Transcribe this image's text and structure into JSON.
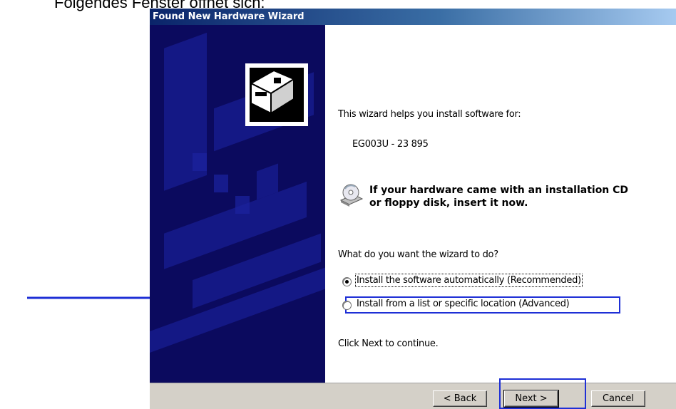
{
  "document": {
    "caption": "Folgendes Fenster öffnet sich:"
  },
  "window": {
    "title": "Found New Hardware Wizard"
  },
  "content": {
    "intro": "This wizard helps you install software for:",
    "device_name": "EG003U - 23 895",
    "cd_notice_line1": "If your hardware came with an installation CD",
    "cd_notice_line2": "or floppy disk, insert it now.",
    "question": "What do you want the wizard to do?",
    "options": [
      {
        "label": "Install the software automatically (Recommended)",
        "selected": true
      },
      {
        "label": "Install from a list or specific location (Advanced)",
        "selected": false
      }
    ],
    "footer_hint": "Click Next to continue."
  },
  "buttons": {
    "back": "< Back",
    "next": "Next >",
    "cancel": "Cancel"
  },
  "annotation": {
    "highlight_color": "#1e2fd6"
  }
}
